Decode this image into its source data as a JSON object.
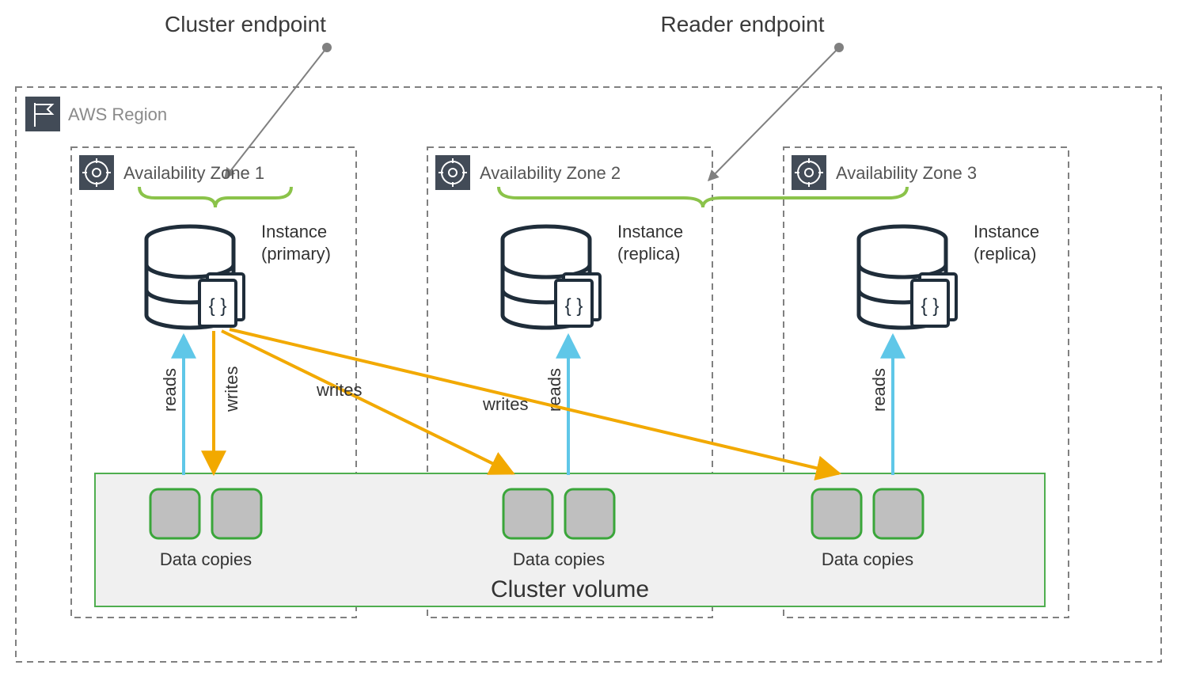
{
  "titles": {
    "cluster_endpoint": "Cluster endpoint",
    "reader_endpoint": "Reader endpoint"
  },
  "region": {
    "label": "AWS Region"
  },
  "zones": [
    {
      "label": "Availability Zone 1",
      "instance_label_line1": "Instance",
      "instance_label_line2": "(primary)",
      "data_copies_label": "Data copies"
    },
    {
      "label": "Availability Zone 2",
      "instance_label_line1": "Instance",
      "instance_label_line2": "(replica)",
      "data_copies_label": "Data copies"
    },
    {
      "label": "Availability Zone 3",
      "instance_label_line1": "Instance",
      "instance_label_line2": "(replica)",
      "data_copies_label": "Data copies"
    }
  ],
  "flows": {
    "reads": "reads",
    "writes": "writes"
  },
  "cluster_volume_label": "Cluster volume",
  "colors": {
    "dash": "#808080",
    "brace": "#8bc34a",
    "read": "#5fc7e8",
    "write": "#f2a900",
    "iconbg": "#424b57",
    "volfill": "#f0f0f0",
    "volstroke": "#4fae4f",
    "copyfill": "#bfbfbf",
    "copystroke": "#3aa63a"
  }
}
